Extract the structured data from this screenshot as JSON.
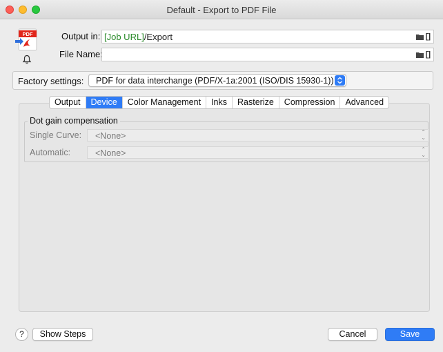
{
  "window": {
    "title": "Default - Export to PDF File"
  },
  "header": {
    "pdf_badge": "PDF",
    "output_label": "Output in:",
    "output_token": "[Job URL]",
    "output_rest": "/Export",
    "filename_label": "File Name:",
    "filename_value": ""
  },
  "factory": {
    "label": "Factory settings:",
    "selected": "PDF for data interchange (PDF/X-1a:2001 (ISO/DIS 15930-1))"
  },
  "tabs": [
    {
      "label": "Output",
      "active": false
    },
    {
      "label": "Device",
      "active": true
    },
    {
      "label": "Color Management",
      "active": false
    },
    {
      "label": "Inks",
      "active": false
    },
    {
      "label": "Rasterize",
      "active": false
    },
    {
      "label": "Compression",
      "active": false
    },
    {
      "label": "Advanced",
      "active": false
    }
  ],
  "dot_gain": {
    "title": "Dot gain compensation",
    "single_curve_label": "Single Curve:",
    "single_curve_value": "<None>",
    "automatic_label": "Automatic:",
    "automatic_value": "<None>"
  },
  "footer": {
    "help": "?",
    "show_steps": "Show Steps",
    "cancel": "Cancel",
    "save": "Save"
  },
  "colors": {
    "accent": "#2f7cf6",
    "token_green": "#2a8a2a",
    "pdf_red": "#e1251b"
  },
  "icons": [
    "pdf-export-icon",
    "bell-icon",
    "folder-icon",
    "variable-bracket-icon",
    "chevron-updown-icon"
  ]
}
